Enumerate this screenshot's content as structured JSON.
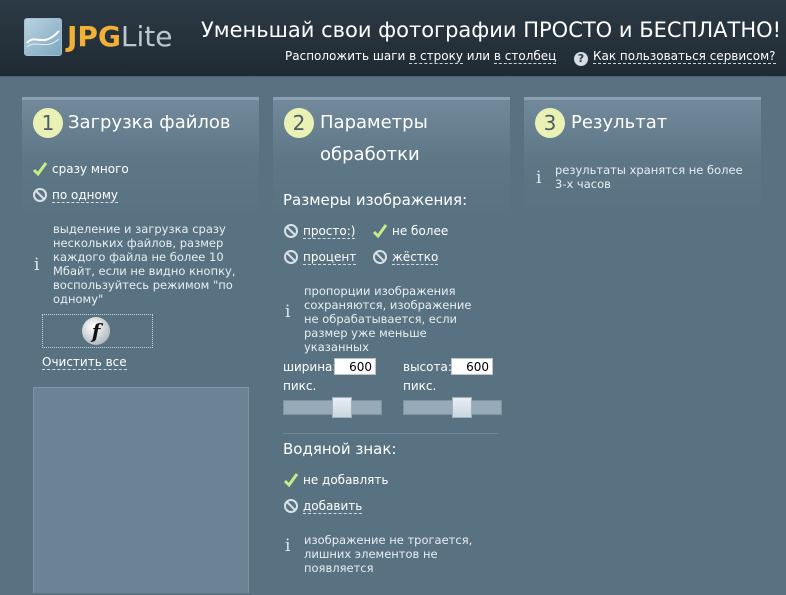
{
  "header": {
    "logo_jpg": "JPG",
    "logo_lite": "Lite",
    "slogan": "Уменьшай свои фотографии ПРОСТО и БЕСПЛАТНО!",
    "arrange_prefix": "Расположить шаги",
    "arrange_row": "в строку",
    "arrange_or": "или",
    "arrange_col": "в столбец",
    "help_symbol": "?",
    "help_link": "Как пользоваться сервисом?"
  },
  "step1": {
    "number": "1",
    "title": "Загрузка файлов",
    "opt_many": "сразу много",
    "opt_one": "по одному",
    "info": "выделение и загрузка сразу нескольких файлов, размер каждого файла не более 10 Мбайт, если не видно кнопку, воспользуйтесь режимом \"по одному\"",
    "flash_glyph": "f",
    "clear_all": "Очистить все"
  },
  "step2": {
    "number": "2",
    "title": "Параметры обработки",
    "size_header": "Размеры изображения:",
    "opt_simple": "просто:)",
    "opt_max": "не более",
    "opt_percent": "процент",
    "opt_strict": "жёстко",
    "size_info": "пропорции изображения сохраняются, изображение не обрабатывается, если размер уже меньше указанных",
    "width_label": "ширина:",
    "width_unit": "пикс.",
    "width_value": "600",
    "height_label": "высота:",
    "height_unit": "пикс.",
    "height_value": "600",
    "watermark_header": "Водяной знак:",
    "wm_none": "не добавлять",
    "wm_add": "добавить",
    "wm_info": "изображение не трогается, лишних элементов не появляется"
  },
  "step3": {
    "number": "3",
    "title": "Результат",
    "info": "результаты хранятся не более 3-х часов"
  },
  "info_glyph": "i",
  "colors": {
    "background": "#587281",
    "header": "#2c3a45",
    "logo_orange": "#f2b035",
    "badge": "#e9f1b4",
    "check_green": "#c9ec86"
  }
}
